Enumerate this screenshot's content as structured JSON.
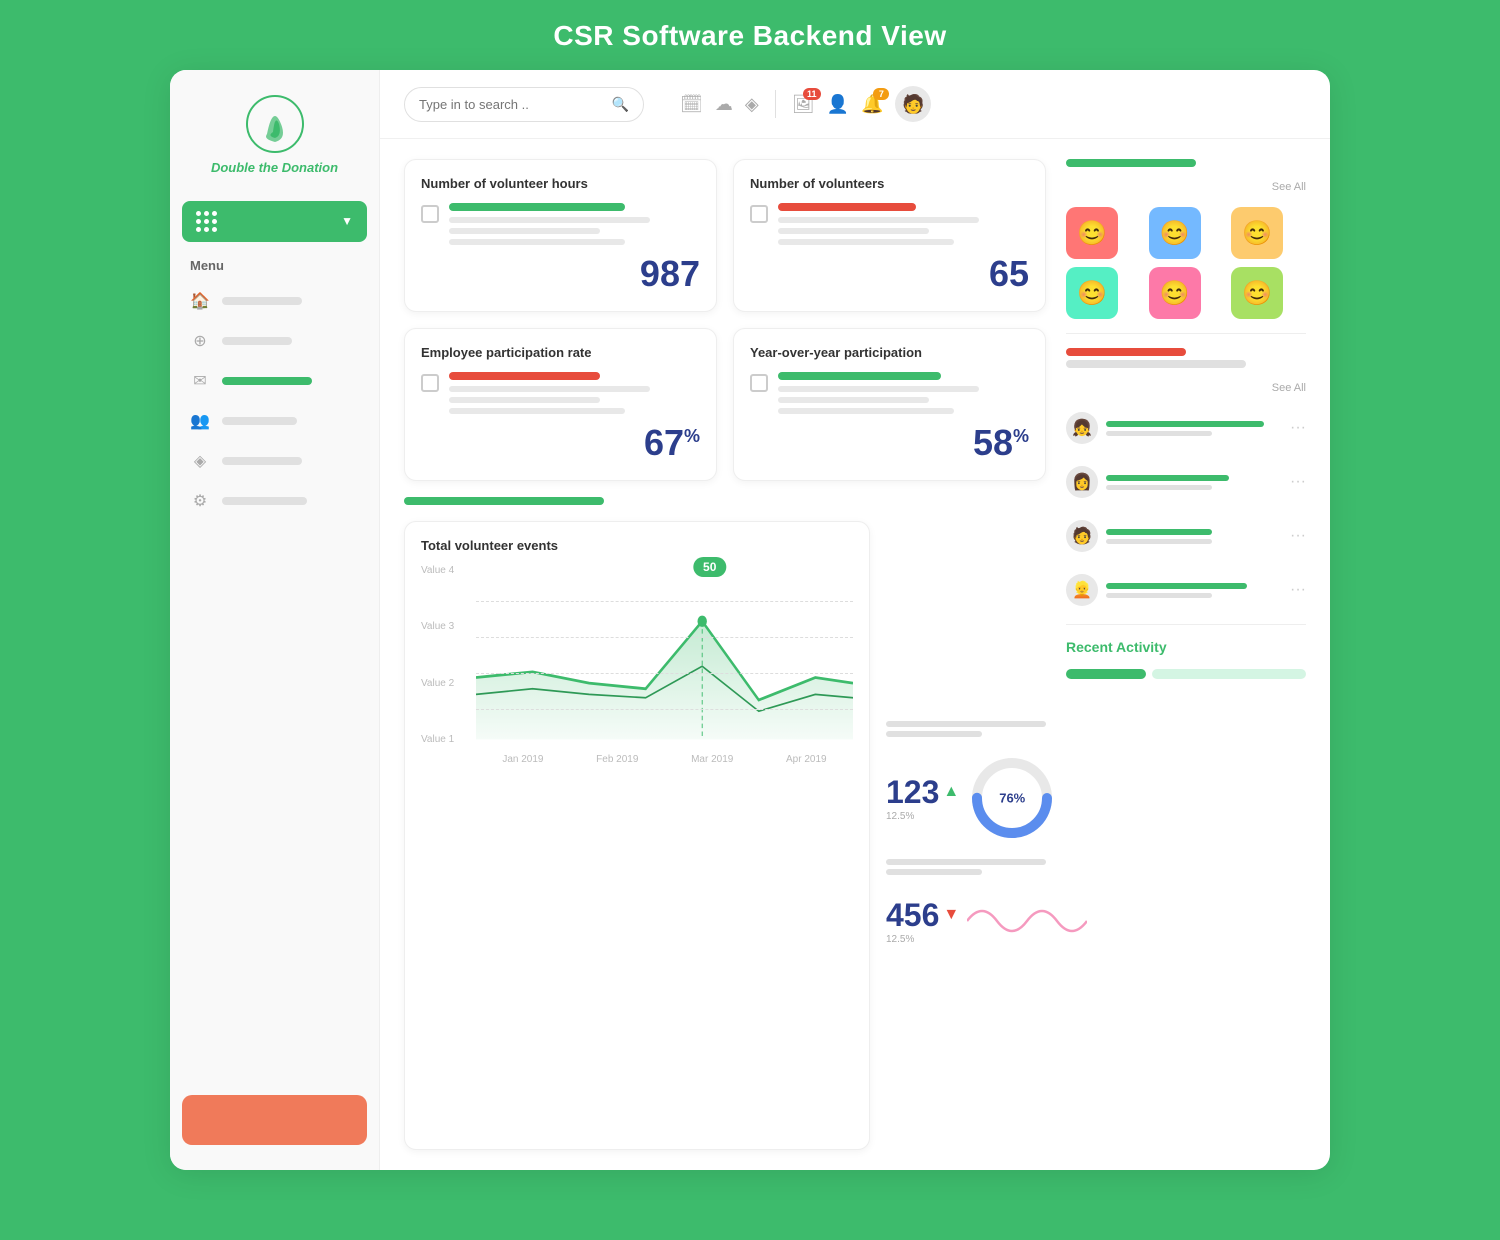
{
  "page": {
    "title": "CSR Software Backend View"
  },
  "header": {
    "search_placeholder": "Type in to search ..",
    "badge_count_1": "11",
    "badge_count_2": "7"
  },
  "sidebar": {
    "logo_text": "Double the Donation",
    "menu_label": "Menu",
    "dropdown_button": "⠿",
    "nav_items": [
      {
        "icon": "🏠",
        "label": "Home",
        "has_green": false
      },
      {
        "icon": "⊕",
        "label": "Add",
        "has_green": false
      },
      {
        "icon": "✉",
        "label": "Messages",
        "has_green": true
      },
      {
        "icon": "👥",
        "label": "Users",
        "has_green": false
      },
      {
        "icon": "◈",
        "label": "Layers",
        "has_green": false
      },
      {
        "icon": "⚙",
        "label": "Settings",
        "has_green": false
      }
    ],
    "cta_button": ""
  },
  "stats": [
    {
      "title": "Number of volunteer hours",
      "value": "987",
      "bar_color": "green",
      "suffix": ""
    },
    {
      "title": "Number of volunteers",
      "value": "65",
      "bar_color": "red",
      "suffix": ""
    },
    {
      "title": "Employee participation rate",
      "value": "67",
      "bar_color": "orange-red",
      "suffix": "%"
    },
    {
      "title": "Year-over-year participation",
      "value": "58",
      "bar_color": "green2",
      "suffix": "%"
    }
  ],
  "chart": {
    "title": "Total volunteer events",
    "tooltip_value": "50",
    "y_labels": [
      "Value 4",
      "Value 3",
      "Value 2",
      "Value 1"
    ],
    "x_labels": [
      "Jan 2019",
      "Feb 2019",
      "Mar 2019",
      "Apr 2019"
    ]
  },
  "mid_stats": [
    {
      "value": "123",
      "direction": "up",
      "percent": "12.5%",
      "donut": "76%"
    },
    {
      "value": "456",
      "direction": "down",
      "percent": "12.5%"
    }
  ],
  "avatars": [
    {
      "color": "red",
      "emoji": "😊"
    },
    {
      "color": "blue",
      "emoji": "😊"
    },
    {
      "color": "orange",
      "emoji": "😊"
    },
    {
      "color": "teal",
      "emoji": "😊"
    },
    {
      "color": "pink",
      "emoji": "😊"
    },
    {
      "color": "green",
      "emoji": "😊"
    }
  ],
  "right_panel": {
    "see_all_1": "See All",
    "see_all_2": "See All",
    "recent_activity_label": "Recent Activity"
  },
  "people": [
    {
      "emoji": "👧"
    },
    {
      "emoji": "👩"
    },
    {
      "emoji": "🧑"
    },
    {
      "emoji": "👱"
    }
  ]
}
